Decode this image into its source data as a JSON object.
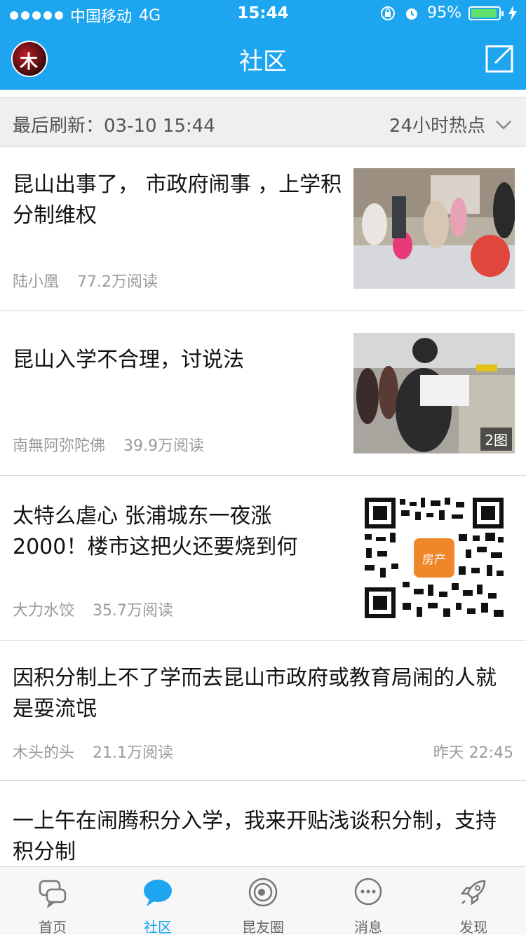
{
  "status_bar": {
    "carrier": "中国移动",
    "network": "4G",
    "time": "15:44",
    "battery": "95%",
    "battery_level": 0.95
  },
  "header": {
    "title": "社区",
    "avatar_text": "木"
  },
  "refresh_bar": {
    "last_refresh": "最后刷新：03-10  15:44",
    "filter_label": "24小时热点"
  },
  "posts": [
    {
      "title": "昆山出事了， 市政府闹事 ，上学积分制维权",
      "author": "陆小凰",
      "reads": "77.2万阅读"
    },
    {
      "title": "昆山入学不合理，讨说法",
      "author": "南無阿弥陀佛",
      "reads": "39.9万阅读",
      "badge": "2图"
    },
    {
      "title": "太特么虐心 张浦城东一夜涨2000！楼市这把火还要烧到何",
      "author": "大力水饺",
      "reads": "35.7万阅读",
      "qr_label": "房产"
    },
    {
      "title": "因积分制上不了学而去昆山市政府或教育局闹的人就是耍流氓",
      "author": "木头的头",
      "reads": "21.1万阅读",
      "time": "昨天 22:45"
    },
    {
      "title": "一上午在闹腾积分入学，我来开贴浅谈积分制，支持积分制"
    }
  ],
  "tabs": [
    {
      "label": "首页",
      "icon": "home-chat-icon"
    },
    {
      "label": "社区",
      "icon": "community-bubble-icon"
    },
    {
      "label": "昆友圈",
      "icon": "circle-eye-icon"
    },
    {
      "label": "消息",
      "icon": "message-icon"
    },
    {
      "label": "发现",
      "icon": "rocket-icon"
    }
  ],
  "colors": {
    "brand": "#1da5f0",
    "meta_text": "#9a9a9a"
  }
}
